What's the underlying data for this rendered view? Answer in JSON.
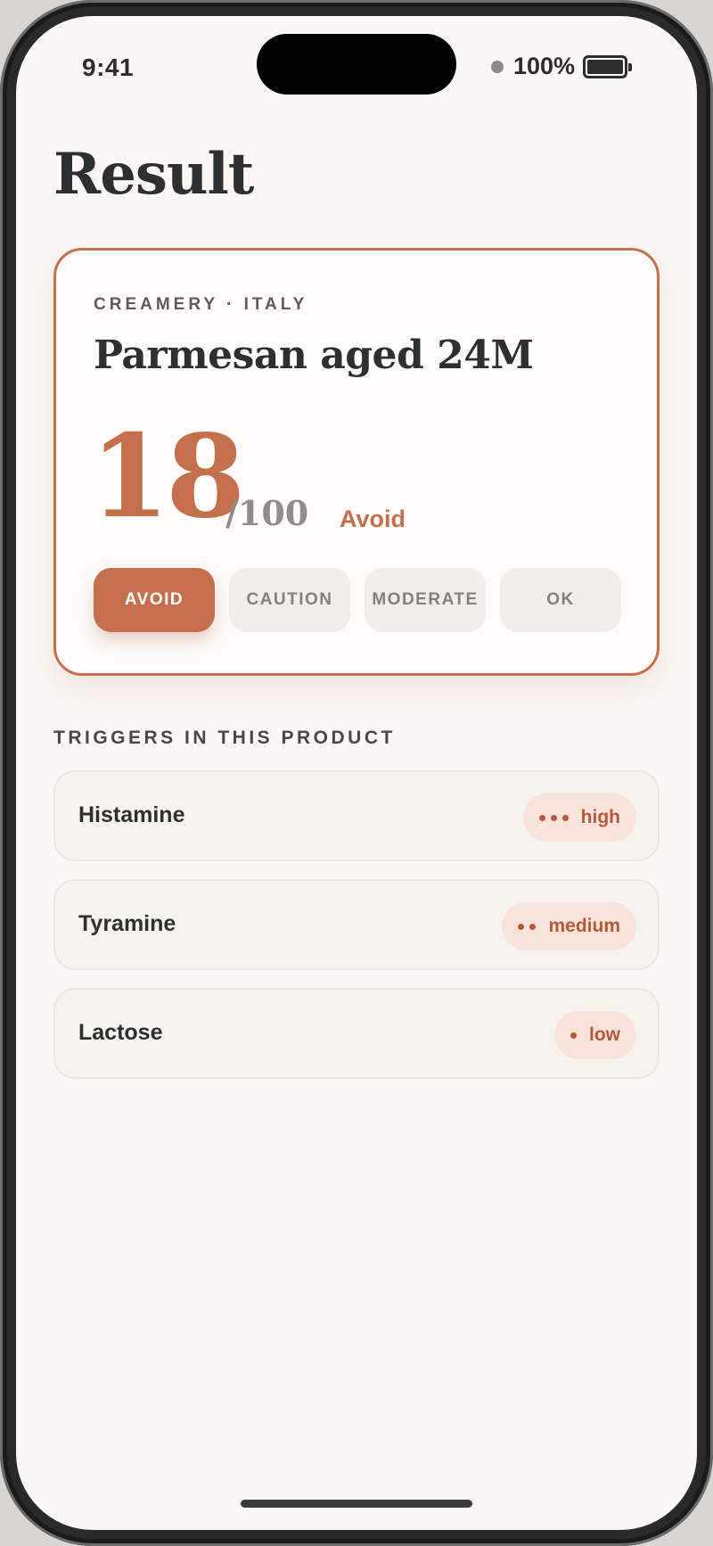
{
  "status_bar": {
    "time": "9:41",
    "battery_percent": "100%"
  },
  "page": {
    "title": "Result"
  },
  "product": {
    "origin": "CREAMERY · ITALY",
    "name": "Parmesan aged 24M",
    "score": "18",
    "score_max": "/100",
    "verdict": "Avoid"
  },
  "levels": {
    "selected": "AVOID",
    "items": [
      "AVOID",
      "CAUTION",
      "MODERATE",
      "OK"
    ]
  },
  "triggers": {
    "heading": "TRIGGERS IN THIS PRODUCT",
    "items": [
      {
        "name": "Histamine",
        "level": "high",
        "dots": 3
      },
      {
        "name": "Tyramine",
        "level": "medium",
        "dots": 2
      },
      {
        "name": "Lactose",
        "level": "low",
        "dots": 1
      }
    ]
  },
  "colors": {
    "accent": "#c4704d",
    "badge_bg": "#f7e3d9",
    "badge_text": "#b5593a",
    "background": "#faf7f4"
  }
}
